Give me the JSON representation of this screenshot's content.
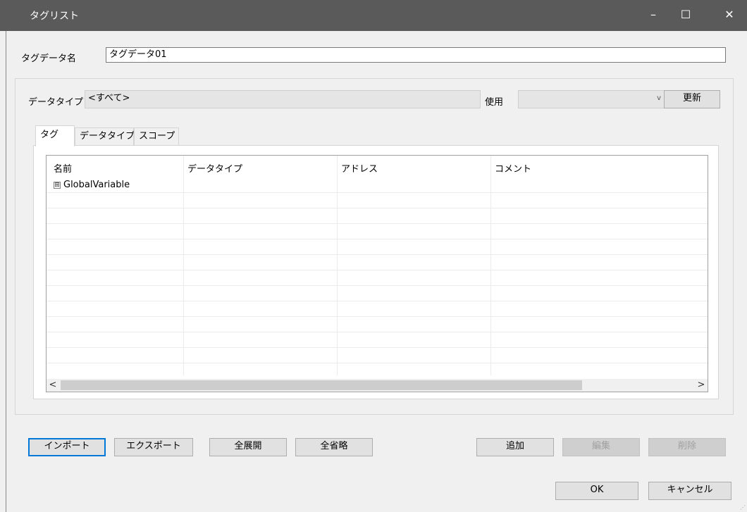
{
  "window": {
    "title": "タグリスト",
    "minimize": "–",
    "maximize": "☐",
    "close": "✕"
  },
  "tag_data_name": {
    "label": "タグデータ名",
    "value": "タグデータ01"
  },
  "filter": {
    "datatype_label": "データタイプ",
    "datatype_value": "<すべて>",
    "usage_label": "使用",
    "usage_value": "",
    "refresh_button": "更新"
  },
  "tabs": [
    {
      "label": "タグ",
      "active": true
    },
    {
      "label": "データタイプ",
      "active": false
    },
    {
      "label": "スコープ",
      "active": false
    }
  ],
  "grid": {
    "columns": [
      "名前",
      "データタイプ",
      "アドレス",
      "コメント"
    ],
    "rows": [
      {
        "expander": "⊞",
        "name": "GlobalVariable",
        "datatype": "",
        "address": "",
        "comment": ""
      }
    ],
    "scroll_left": "<",
    "scroll_right": ">"
  },
  "buttons": {
    "import": "インポート",
    "export": "エクスポート",
    "expand_all": "全展開",
    "collapse_all": "全省略",
    "add": "追加",
    "edit": "編集",
    "delete": "削除",
    "ok": "OK",
    "cancel": "キャンセル"
  },
  "colors": {
    "titlebar": "#5a5a5a",
    "focus": "#0078d7",
    "background": "#f0f0f0"
  }
}
